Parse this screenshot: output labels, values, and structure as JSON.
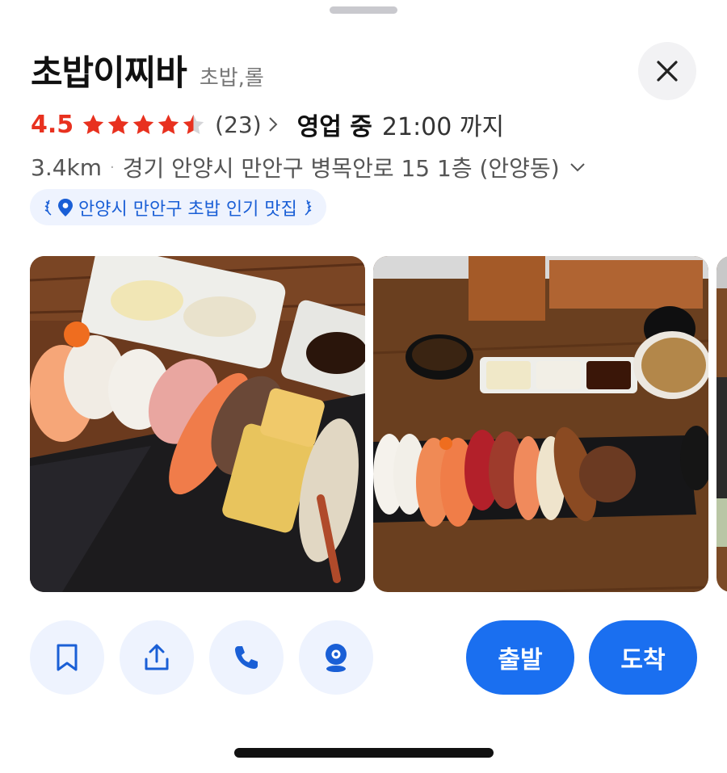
{
  "place": {
    "name": "초밥이찌바",
    "category": "초밥,롤"
  },
  "rating": {
    "score": "4.5",
    "stars": 4.5,
    "review_count": "(23)",
    "accent_color": "#e8311f"
  },
  "hours": {
    "status": "영업 중",
    "until": "21:00 까지"
  },
  "address": {
    "distance": "3.4km",
    "separator": "·",
    "text": "경기 안양시 만안구 병목안로 15 1층 (안양동)"
  },
  "badge": {
    "label": "안양시 만안구 초밥 인기 맛집",
    "color": "#1a5fd6"
  },
  "photos": [
    {
      "icon": "sushi-platter-photo"
    },
    {
      "icon": "sushi-set-table-photo"
    },
    {
      "icon": "partial-photo"
    }
  ],
  "actions": [
    {
      "icon": "bookmark-icon"
    },
    {
      "icon": "share-icon"
    },
    {
      "icon": "phone-icon"
    },
    {
      "icon": "street-view-icon"
    }
  ],
  "route": {
    "depart_label": "출발",
    "arrive_label": "도착",
    "button_color": "#1a6ff0"
  }
}
